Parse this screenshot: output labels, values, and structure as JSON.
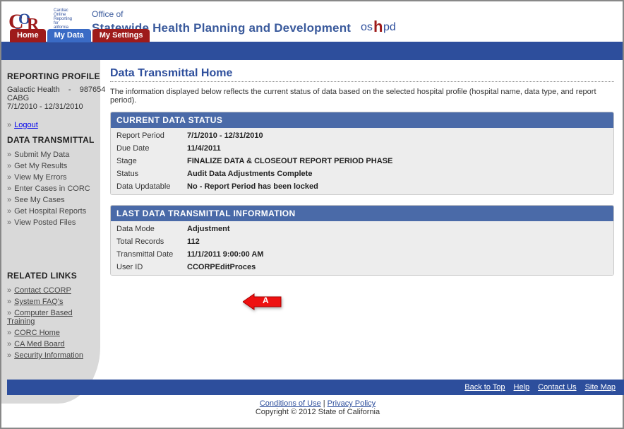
{
  "header": {
    "office_of": "Office of",
    "title": "Statewide Health Planning and Development",
    "logo_small_lines": [
      "Cardiac",
      "Online",
      "Reporting",
      "for",
      "alifornia"
    ]
  },
  "tabs": [
    {
      "label": "Home"
    },
    {
      "label": "My Data"
    },
    {
      "label": "My Settings"
    }
  ],
  "sidebar": {
    "profile_heading": "REPORTING PROFILE",
    "profile_line1": "Galactic Health    -    987654",
    "profile_line2": "CABG",
    "profile_line3": "7/1/2010 - 12/31/2010",
    "logout": "Logout",
    "dt_heading": "DATA TRANSMITTAL",
    "dt_links": [
      "Submit My Data",
      "Get My Results",
      "View My Errors",
      "Enter Cases in CORC",
      "See My Cases",
      "Get Hospital Reports",
      "View Posted Files"
    ],
    "rl_heading": "RELATED LINKS",
    "rl_links": [
      "Contact CCORP",
      "System FAQ's",
      "Computer Based Training",
      "CORC Home",
      "CA Med Board",
      "Security Information"
    ]
  },
  "main": {
    "title": "Data Transmittal Home",
    "subtitle": "The information displayed below reflects the current status of data based on the selected hospital profile (hospital name, data type, and report period).",
    "current_status": {
      "heading": "CURRENT DATA STATUS",
      "rows": [
        {
          "k": "Report Period",
          "v": "7/1/2010 - 12/31/2010"
        },
        {
          "k": "Due Date",
          "v": "11/4/2011"
        },
        {
          "k": "Stage",
          "v": "FINALIZE DATA & CLOSEOUT REPORT PERIOD PHASE"
        },
        {
          "k": "Status",
          "v": "Audit Data Adjustments Complete"
        },
        {
          "k": "Data Updatable",
          "v": "No - Report Period has been locked"
        }
      ]
    },
    "last_transmittal": {
      "heading": "LAST DATA TRANSMITTAL INFORMATION",
      "rows": [
        {
          "k": "Data Mode",
          "v": "Adjustment"
        },
        {
          "k": "Total Records",
          "v": "112"
        },
        {
          "k": "Transmittal Date",
          "v": "11/1/2011 9:00:00 AM"
        },
        {
          "k": "User ID",
          "v": "CCORPEditProces"
        }
      ]
    },
    "callout_label": "A"
  },
  "footer": {
    "links": [
      "Back to Top",
      "Help",
      "Contact Us",
      "Site Map"
    ],
    "conditions": "Conditions of Use",
    "privacy": "Privacy Policy",
    "sep": " | ",
    "copyright": "Copyright © 2012 State of California"
  }
}
